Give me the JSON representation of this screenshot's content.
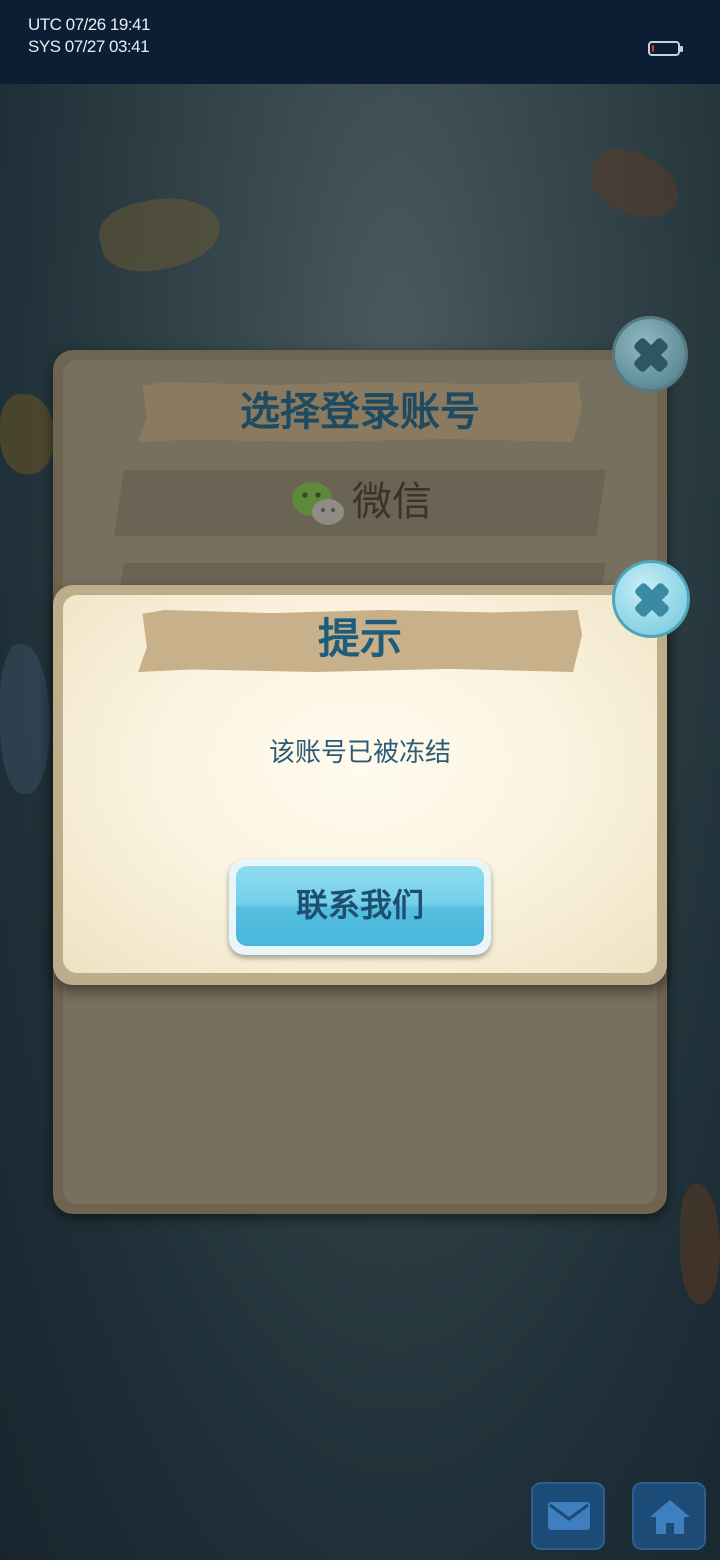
{
  "status_bar": {
    "utc": "UTC 07/26 19:41",
    "sys": "SYS 07/27 03:41",
    "battery_level": 0.08
  },
  "login_panel": {
    "title": "选择登录账号",
    "wechat_label": "微信"
  },
  "alert": {
    "title": "提示",
    "message": "该账号已被冻结",
    "button_label": "联系我们"
  },
  "icons": {
    "close": "close-icon",
    "wechat": "wechat-icon",
    "mail": "mail-icon",
    "home": "home-icon"
  },
  "colors": {
    "title_text": "#1f5c7a",
    "button_blue": "#73cfe8",
    "status_bar_bg": "#0b1e33"
  }
}
